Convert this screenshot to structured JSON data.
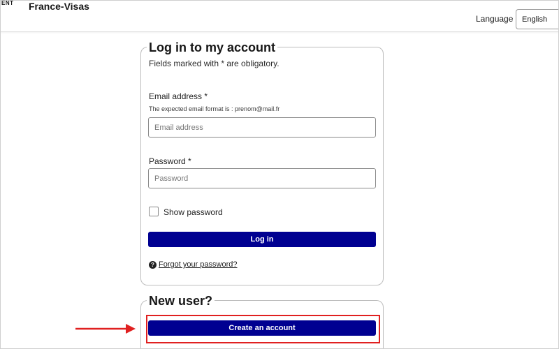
{
  "header": {
    "gov_fragment": "ENT",
    "site_name": "France-Visas",
    "language_label": "Language :",
    "language_value": "English"
  },
  "login": {
    "title": "Log in to my account",
    "obligatory_note": "Fields marked with * are obligatory.",
    "email_label": "Email address *",
    "email_hint": "The expected email format is : prenom@mail.fr",
    "email_placeholder": "Email address",
    "password_label": "Password *",
    "password_placeholder": "Password",
    "show_password_label": "Show password",
    "login_button": "Log in",
    "help_glyph": "?",
    "forgot_link": "Forgot your password?"
  },
  "new_user": {
    "title": "New user?",
    "create_button": "Create an account"
  },
  "colors": {
    "primary": "#000091",
    "highlight": "#e02020"
  },
  "icons": {
    "help": "question-circle-icon",
    "arrow": "right-arrow-icon"
  }
}
